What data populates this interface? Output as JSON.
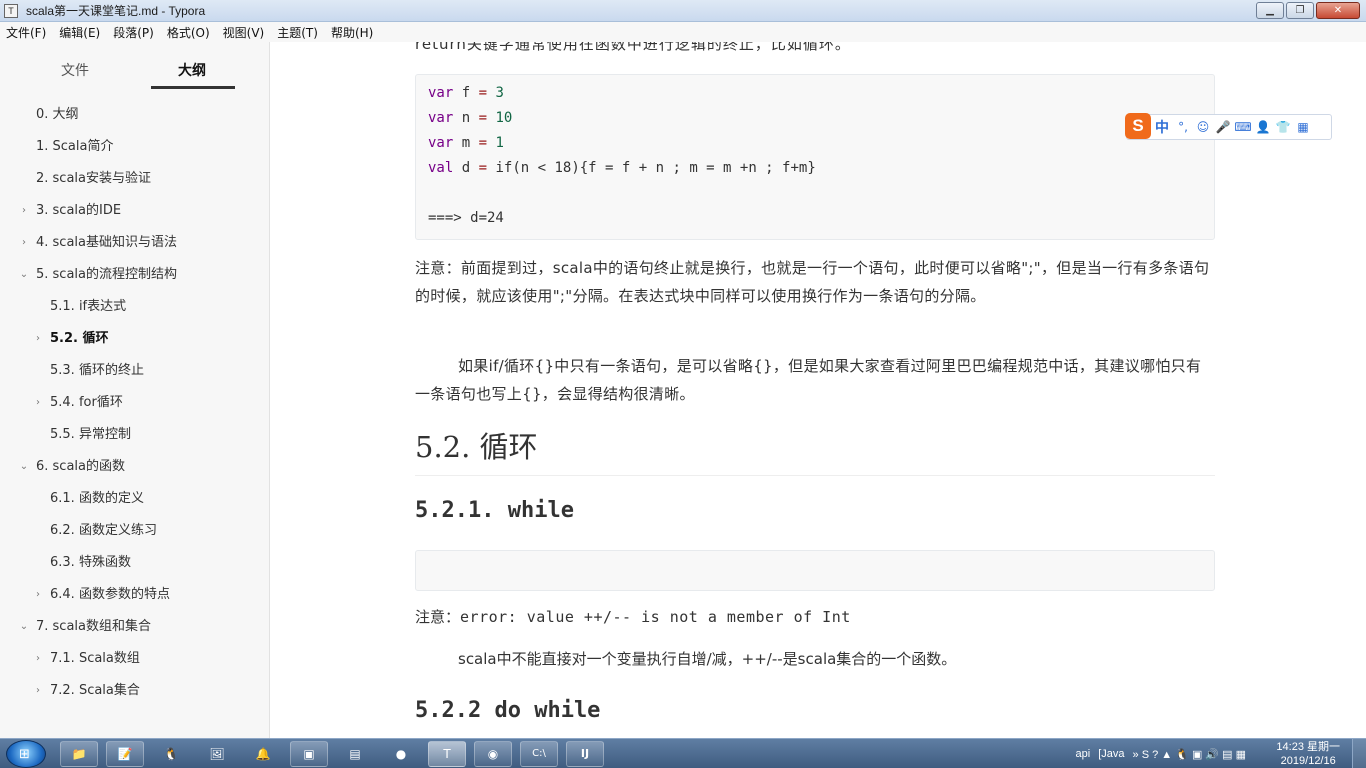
{
  "window": {
    "app_icon": "T",
    "title": "scala第一天课堂笔记.md - Typora",
    "minimize": "▁",
    "maximize": "❐",
    "close": "✕"
  },
  "menu": [
    "文件(F)",
    "编辑(E)",
    "段落(P)",
    "格式(O)",
    "视图(V)",
    "主题(T)",
    "帮助(H)"
  ],
  "sidebar": {
    "tabs": {
      "files": "文件",
      "outline": "大纲"
    },
    "outline": [
      {
        "label": "0. 大纲",
        "level": 1,
        "arrow": ""
      },
      {
        "label": "1. Scala简介",
        "level": 1,
        "arrow": ""
      },
      {
        "label": "2. scala安装与验证",
        "level": 1,
        "arrow": ""
      },
      {
        "label": "3. scala的IDE",
        "level": 1,
        "arrow": "›"
      },
      {
        "label": "4. scala基础知识与语法",
        "level": 1,
        "arrow": "›"
      },
      {
        "label": "5. scala的流程控制结构",
        "level": 1,
        "arrow": "⌄"
      },
      {
        "label": "5.1. if表达式",
        "level": 2,
        "arrow": ""
      },
      {
        "label": "5.2. 循环",
        "level": 2,
        "arrow": "›",
        "active": true
      },
      {
        "label": "5.3. 循环的终止",
        "level": 2,
        "arrow": ""
      },
      {
        "label": "5.4. for循环",
        "level": 2,
        "arrow": "›"
      },
      {
        "label": "5.5. 异常控制",
        "level": 2,
        "arrow": ""
      },
      {
        "label": "6. scala的函数",
        "level": 1,
        "arrow": "⌄"
      },
      {
        "label": "6.1. 函数的定义",
        "level": 2,
        "arrow": ""
      },
      {
        "label": "6.2. 函数定义练习",
        "level": 2,
        "arrow": ""
      },
      {
        "label": "6.3. 特殊函数",
        "level": 2,
        "arrow": ""
      },
      {
        "label": "6.4. 函数参数的特点",
        "level": 2,
        "arrow": "›"
      },
      {
        "label": "7. scala数组和集合",
        "level": 1,
        "arrow": "⌄"
      },
      {
        "label": "7.1. Scala数组",
        "level": 2,
        "arrow": "›"
      },
      {
        "label": "7.2. Scala集合",
        "level": 2,
        "arrow": "›"
      }
    ]
  },
  "editor": {
    "top_partial": "return关键字通常使用在函数中进行逻辑的终止，比如循环。",
    "code": {
      "line1": {
        "kw": "var",
        "name": " f ",
        "op": "=",
        "val": " 3"
      },
      "line2": {
        "kw": "var",
        "name": " n ",
        "op": "=",
        "val": " 10"
      },
      "line3": {
        "kw": "var",
        "name": " m ",
        "op": "=",
        "val": " 1"
      },
      "line4": {
        "kw": "val",
        "name": " d ",
        "op": "=",
        "rest": " if(n < 18){f = f + n ; m = m +n ; f+m}"
      },
      "line5": "===> d=24"
    },
    "note1": "注意：前面提到过，scala中的语句终止就是换行，也就是一行一个语句，此时便可以省略\";\"，但是当一行有多条语句的时候，就应该使用\";\"分隔。在表达式块中同样可以使用换行作为一条语句的分隔。",
    "para2": "如果if/循环{}中只有一条语句，是可以省略{}，但是如果大家查看过阿里巴巴编程规范中话，其建议哪怕只有一条语句也写上{}，会显得结构很清晰。",
    "h2": "5.2. 循环",
    "h3_while": "5.2.1. while",
    "note2_prefix": "注意：",
    "note2_code": "error: value ++/-- is not a member of Int",
    "para3": "scala中不能直接对一个变量执行自增/减，++/--是scala集合的一个函数。",
    "h3_dowhile": "5.2.2 do while"
  },
  "ime": {
    "logo": "S",
    "icons": [
      "中",
      "°,",
      "☺",
      "🎤",
      "⌨",
      "👤",
      "👕",
      "▦"
    ]
  },
  "taskbar": {
    "start_icon": "⊞",
    "buttons": [
      "📁",
      "📝",
      "🐧",
      "🖼",
      "🔔",
      "▣",
      "▤",
      "●",
      "T",
      "◉",
      "C:\\",
      "IJ"
    ],
    "tray_text_api": "api",
    "tray_text_java": "[Java",
    "tray_glyphs": "» S ? ▲ 🐧 ▣ 🔊 ▤ ▦",
    "time": "14:23 星期一",
    "date": "2019/12/16"
  },
  "colors": {
    "keyword": "#770088",
    "number": "#116644",
    "operator": "#981a1a",
    "ime_logo": "#f06a1b"
  }
}
